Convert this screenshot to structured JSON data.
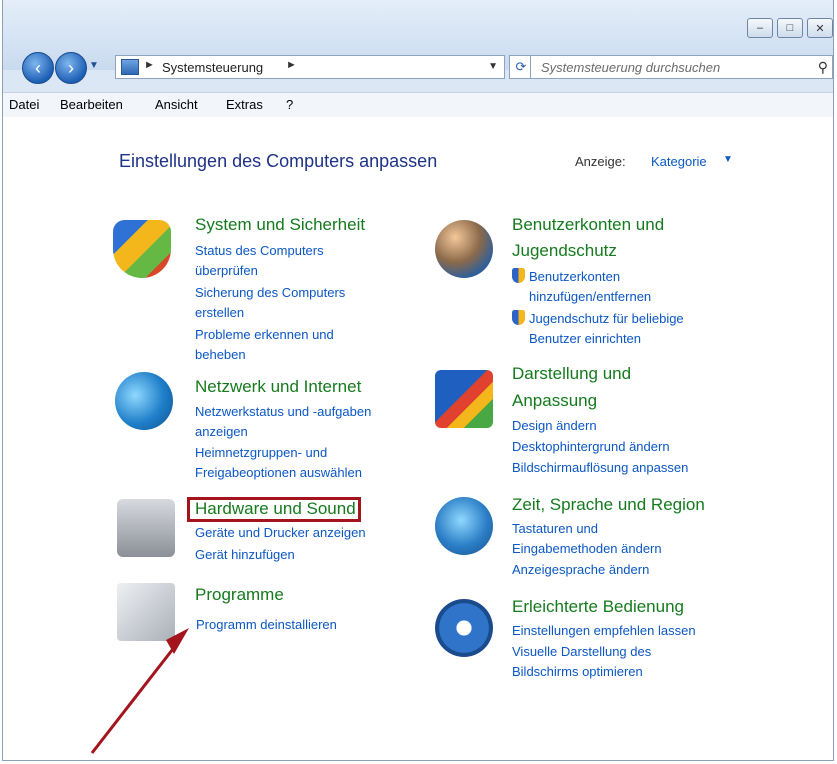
{
  "window": {
    "minimize": "–",
    "maximize": "□",
    "close": "✕"
  },
  "address": {
    "text": "Systemsteuerung",
    "sep1": "►",
    "sep2": "►"
  },
  "search": {
    "placeholder": "Systemsteuerung durchsuchen"
  },
  "menu": [
    "Datei",
    "Bearbeiten",
    "Ansicht",
    "Extras",
    "?"
  ],
  "page": {
    "title": "Einstellungen des Computers anpassen",
    "view_label": "Anzeige:",
    "view_value": "Kategorie"
  },
  "categories": [
    {
      "title": "System und Sicherheit",
      "links": [
        "Status des Computers",
        "überprüfen",
        "Sicherung des Computers",
        "erstellen",
        "Probleme erkennen und",
        "beheben"
      ]
    },
    {
      "title": "Netzwerk und Internet",
      "links": [
        "Netzwerkstatus und -aufgaben",
        "anzeigen",
        "Heimnetzgruppen- und",
        "Freigabeoptionen auswählen"
      ]
    },
    {
      "title": "Hardware und Sound",
      "links": [
        "Geräte und Drucker anzeigen",
        "Gerät hinzufügen"
      ]
    },
    {
      "title": "Programme",
      "links": [
        "Programm deinstallieren"
      ]
    },
    {
      "title_lines": [
        "Benutzerkonten und",
        "Jugendschutz"
      ],
      "links": [
        "Benutzerkonten",
        "hinzufügen/entfernen",
        "Jugendschutz für beliebige",
        "Benutzer einrichten"
      ]
    },
    {
      "title_lines": [
        "Darstellung und",
        "Anpassung"
      ],
      "links": [
        "Design ändern",
        "Desktophintergrund ändern",
        "Bildschirmauflösung anpassen"
      ]
    },
    {
      "title": "Zeit, Sprache und Region",
      "links": [
        "Tastaturen und",
        "Eingabemethoden ändern",
        "Anzeigesprache ändern"
      ]
    },
    {
      "title": "Erleichterte Bedienung",
      "links": [
        "Einstellungen empfehlen lassen",
        "Visuelle Darstellung des",
        "Bildschirms optimieren"
      ]
    }
  ],
  "colors": {
    "link": "#0b57c4",
    "category_title": "#157a1e",
    "page_title": "#1e3287",
    "highlight": "#a3141d"
  }
}
